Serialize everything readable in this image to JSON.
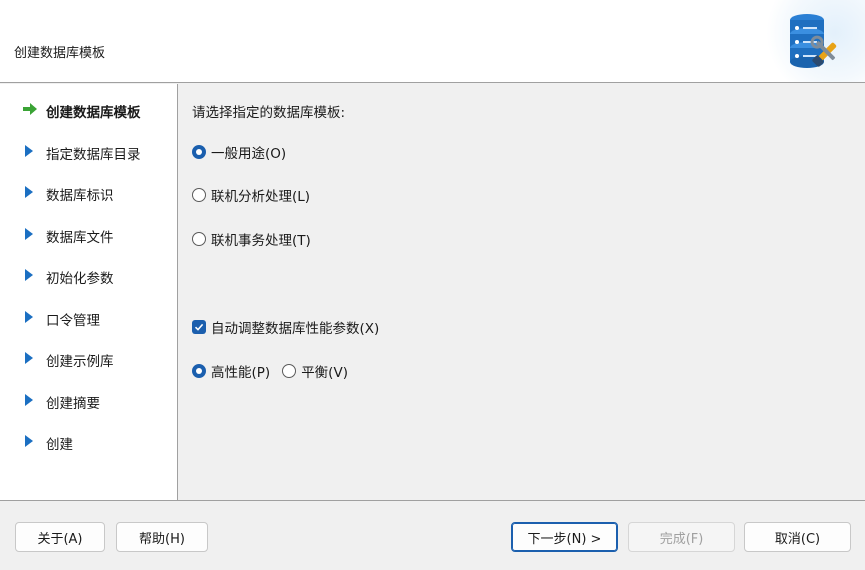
{
  "window": {
    "title": "创建数据库模板"
  },
  "sidebar": {
    "steps": [
      {
        "label": "创建数据库模板",
        "current": true
      },
      {
        "label": "指定数据库目录",
        "current": false
      },
      {
        "label": "数据库标识",
        "current": false
      },
      {
        "label": "数据库文件",
        "current": false
      },
      {
        "label": "初始化参数",
        "current": false
      },
      {
        "label": "口令管理",
        "current": false
      },
      {
        "label": "创建示例库",
        "current": false
      },
      {
        "label": "创建摘要",
        "current": false
      },
      {
        "label": "创建",
        "current": false
      }
    ]
  },
  "content": {
    "prompt": "请选择指定的数据库模板:",
    "templates": [
      {
        "label": "一般用途(O)",
        "selected": true
      },
      {
        "label": "联机分析处理(L)",
        "selected": false
      },
      {
        "label": "联机事务处理(T)",
        "selected": false
      }
    ],
    "auto_tune": {
      "label": "自动调整数据库性能参数(X)",
      "checked": true
    },
    "tune_modes": [
      {
        "label": "高性能(P)",
        "selected": true
      },
      {
        "label": "平衡(V)",
        "selected": false
      }
    ]
  },
  "footer": {
    "about": "关于(A)",
    "help": "帮助(H)",
    "next": "下一步(N) >",
    "finish": "完成(F)",
    "cancel": "取消(C)"
  },
  "colors": {
    "accent": "#1b5fae",
    "step_arrow": "#1b6fc2",
    "current_arrow": "#3aa335"
  }
}
